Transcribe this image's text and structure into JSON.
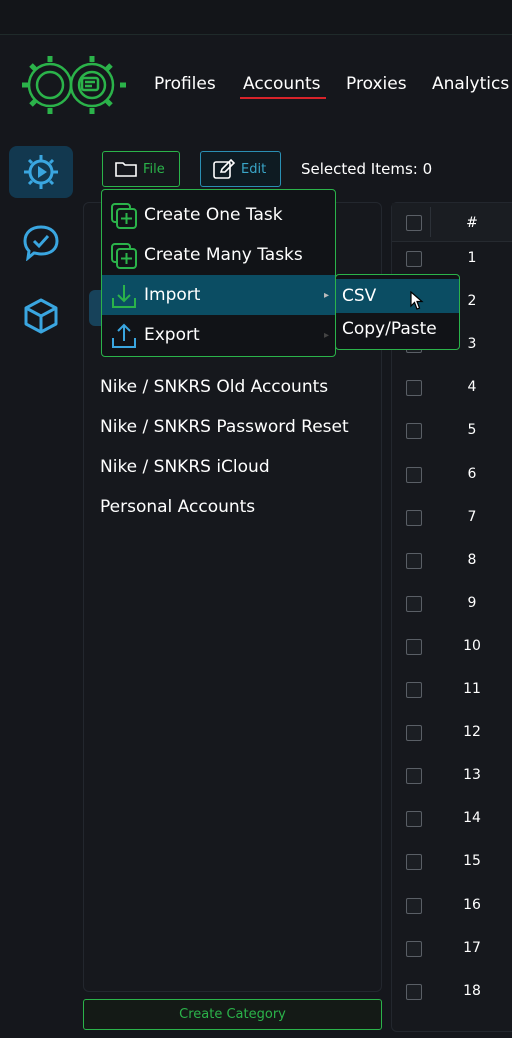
{
  "nav": {
    "items": [
      "Profiles",
      "Accounts",
      "Proxies",
      "Analytics"
    ],
    "active": "Accounts",
    "underline_color": "#d8232a"
  },
  "sidebar": {
    "icons": [
      "gear-settings-icon",
      "chat-check-icon",
      "box-icon"
    ],
    "active_index": 0
  },
  "toolbar": {
    "file_label": "File",
    "edit_label": "Edit",
    "selected_items": "Selected Items: 0"
  },
  "file_menu": {
    "items": [
      {
        "label": "Create One Task",
        "icon": "plus-square-stack-icon"
      },
      {
        "label": "Create Many Tasks",
        "icon": "plus-square-stack-icon"
      },
      {
        "label": "Import",
        "icon": "download-icon",
        "submenu": true,
        "active": true
      },
      {
        "label": "Export",
        "icon": "upload-icon",
        "submenu": true
      }
    ],
    "import_submenu": [
      "CSV",
      "Copy/Paste"
    ]
  },
  "categories": {
    "items": [
      "Nike / SNKRS Old Accounts",
      "Nike / SNKRS Password Reset",
      "Nike / SNKRS iCloud",
      "Personal Accounts"
    ],
    "create_button": "Create Category"
  },
  "table": {
    "header_num": "#",
    "rows": [
      "1",
      "2",
      "3",
      "4",
      "5",
      "6",
      "7",
      "8",
      "9",
      "10",
      "11",
      "12",
      "13",
      "14",
      "15",
      "16",
      "17",
      "18"
    ]
  },
  "colors": {
    "accent_green": "#2bb34a",
    "accent_blue": "#2a8fb3",
    "highlight": "#0b4d63",
    "background": "#15171c"
  }
}
